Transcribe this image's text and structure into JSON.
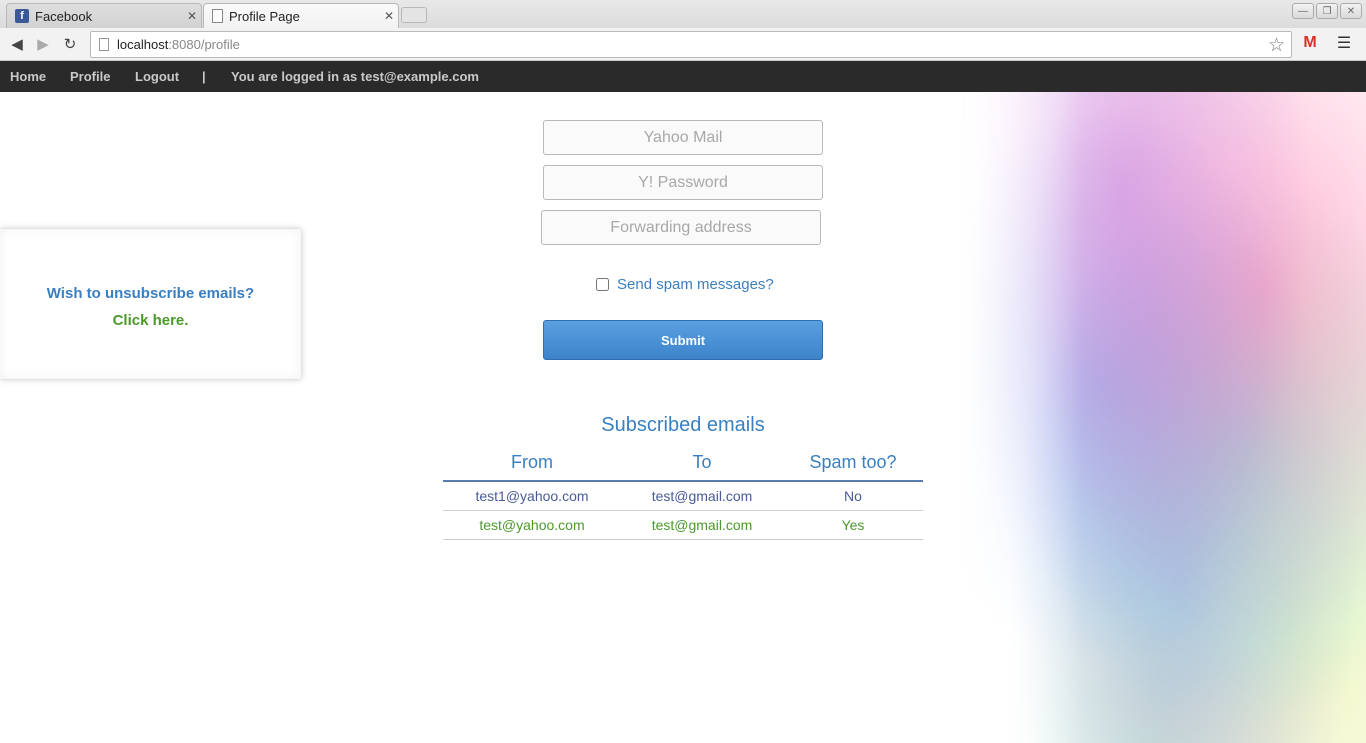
{
  "browser": {
    "tabs": [
      {
        "title": "Facebook",
        "favicon": "facebook-icon"
      },
      {
        "title": "Profile Page",
        "favicon": "page-icon"
      }
    ],
    "url_host": "localhost",
    "url_rest": ":8080/profile"
  },
  "nav": {
    "home": "Home",
    "profile": "Profile",
    "logout": "Logout",
    "separator": "|",
    "logged_in": "You are logged in as test@example.com"
  },
  "form": {
    "yahoo_mail_placeholder": "Yahoo Mail",
    "password_placeholder": "Y! Password",
    "forward_placeholder": "Forwarding address",
    "spam_label": "Send spam messages?",
    "spam_checked": false,
    "submit_label": "Submit"
  },
  "unsubscribe": {
    "question": "Wish to unsubscribe emails?",
    "link": "Click here."
  },
  "subscriptions": {
    "title": "Subscribed emails",
    "headers": [
      "From",
      "To",
      "Spam too?"
    ],
    "rows": [
      {
        "from": "test1@yahoo.com",
        "to": "test@gmail.com",
        "spam": "No"
      },
      {
        "from": "test@yahoo.com",
        "to": "test@gmail.com",
        "spam": "Yes"
      }
    ]
  },
  "colors": {
    "accent_blue": "#3a7fc0",
    "accent_green": "#4a9a2a",
    "navbar_bg": "#2a2a2a"
  }
}
